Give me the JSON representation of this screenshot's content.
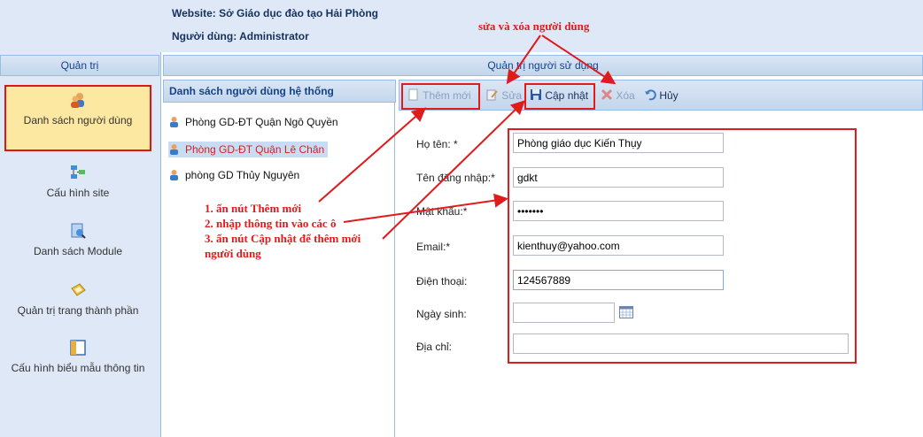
{
  "header": {
    "website": "Website: Sở Giáo dục đào tạo Hải Phòng",
    "user": "Người dùng: Administrator"
  },
  "left_panel": {
    "title": "Quản trị",
    "items": [
      {
        "label": "Danh sách người dùng",
        "icon": "users-icon",
        "selected": true
      },
      {
        "label": "Cấu hình site",
        "icon": "sitemap-icon"
      },
      {
        "label": "Danh sách Module",
        "icon": "module-icon"
      },
      {
        "label": "Quản trị trang thành phần",
        "icon": "components-icon"
      },
      {
        "label": "Cấu hình biểu mẫu thông tin",
        "icon": "form-config-icon"
      }
    ]
  },
  "main": {
    "title": "Quản trị người sử dụng",
    "list_title": "Danh sách người dùng hệ thống",
    "users": [
      {
        "name": "Phòng GD-ĐT Quận Ngô Quyền",
        "selected": false
      },
      {
        "name": "Phòng GD-ĐT Quận Lê Chân",
        "selected": true
      },
      {
        "name": "phòng GD Thủy Nguyên",
        "selected": false
      }
    ]
  },
  "toolbar": {
    "add_label": "Thêm mới",
    "edit_label": "Sửa",
    "update_label": "Cập nhật",
    "delete_label": "Xóa",
    "cancel_label": "Hủy"
  },
  "form": {
    "fullname_label": "Họ tên: *",
    "fullname_value": "Phòng giáo dục Kiến Thụy",
    "username_label": "Tên đăng nhập:*",
    "username_value": "gdkt",
    "password_label": "Mật khẩu:*",
    "password_value": "•••••••",
    "email_label": "Email:*",
    "email_value": "kienthuy@yahoo.com",
    "phone_label": "Điện thoại:",
    "phone_value": "124567889",
    "birthday_label": "Ngày sinh:",
    "birthday_value": "",
    "address_label": "Địa chỉ:",
    "address_value": ""
  },
  "annotations": {
    "edit_delete": "sửa và xóa người dùng",
    "step1": "1. ấn nút Thêm mới",
    "step2": "2. nhập thông tin vào các ô",
    "step3": "3. ấn nút Cập nhật để thêm mới",
    "step3b": "người dùng"
  },
  "colors": {
    "annotation_red": "#e01b1b",
    "panel_blue": "#dfe8f6",
    "selected_row": "#c8dcf3",
    "selected_nav": "#fde8a2"
  }
}
